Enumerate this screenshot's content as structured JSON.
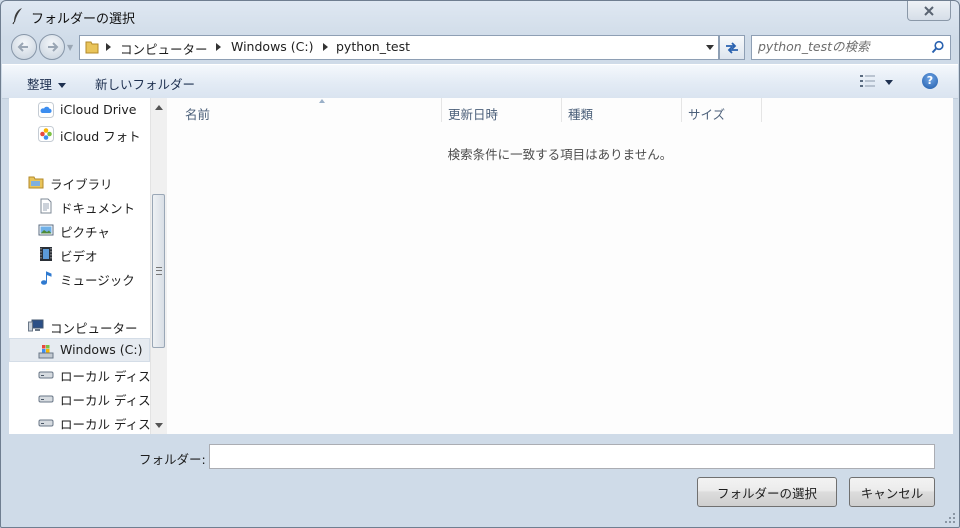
{
  "window": {
    "title": "フォルダーの選択"
  },
  "address": {
    "crumbs": [
      "コンピューター",
      "Windows (C:)",
      "python_test"
    ]
  },
  "search": {
    "placeholder": "python_testの検索"
  },
  "toolbar": {
    "organize": "整理",
    "new_folder": "新しいフォルダー"
  },
  "nav": {
    "items": [
      {
        "label": "iCloud Drive",
        "icon": "icloud-drive-icon"
      },
      {
        "label": "iCloud フォト",
        "icon": "icloud-photos-icon"
      },
      {
        "label": "ライブラリ",
        "icon": "library-icon"
      },
      {
        "label": "ドキュメント",
        "icon": "documents-icon"
      },
      {
        "label": "ピクチャ",
        "icon": "pictures-icon"
      },
      {
        "label": "ビデオ",
        "icon": "videos-icon"
      },
      {
        "label": "ミュージック",
        "icon": "music-icon"
      },
      {
        "label": "コンピューター",
        "icon": "computer-icon"
      },
      {
        "label": "Windows (C:)",
        "icon": "windows-drive-icon"
      },
      {
        "label": "ローカル ディスク",
        "icon": "local-disk-icon"
      },
      {
        "label": "ローカル ディスク",
        "icon": "local-disk-icon"
      },
      {
        "label": "ローカル ディスク",
        "icon": "local-disk-icon"
      }
    ]
  },
  "columns": [
    "名前",
    "更新日時",
    "種類",
    "サイズ"
  ],
  "empty_message": "検索条件に一致する項目はありません。",
  "bottom": {
    "folder_label": "フォルダー:",
    "folder_value": "",
    "select_button": "フォルダーの選択",
    "cancel_button": "キャンセル"
  },
  "colors": {
    "accent": "#1f5aa8",
    "toolbar_text": "#1e3050",
    "column_text": "#4c607a"
  }
}
